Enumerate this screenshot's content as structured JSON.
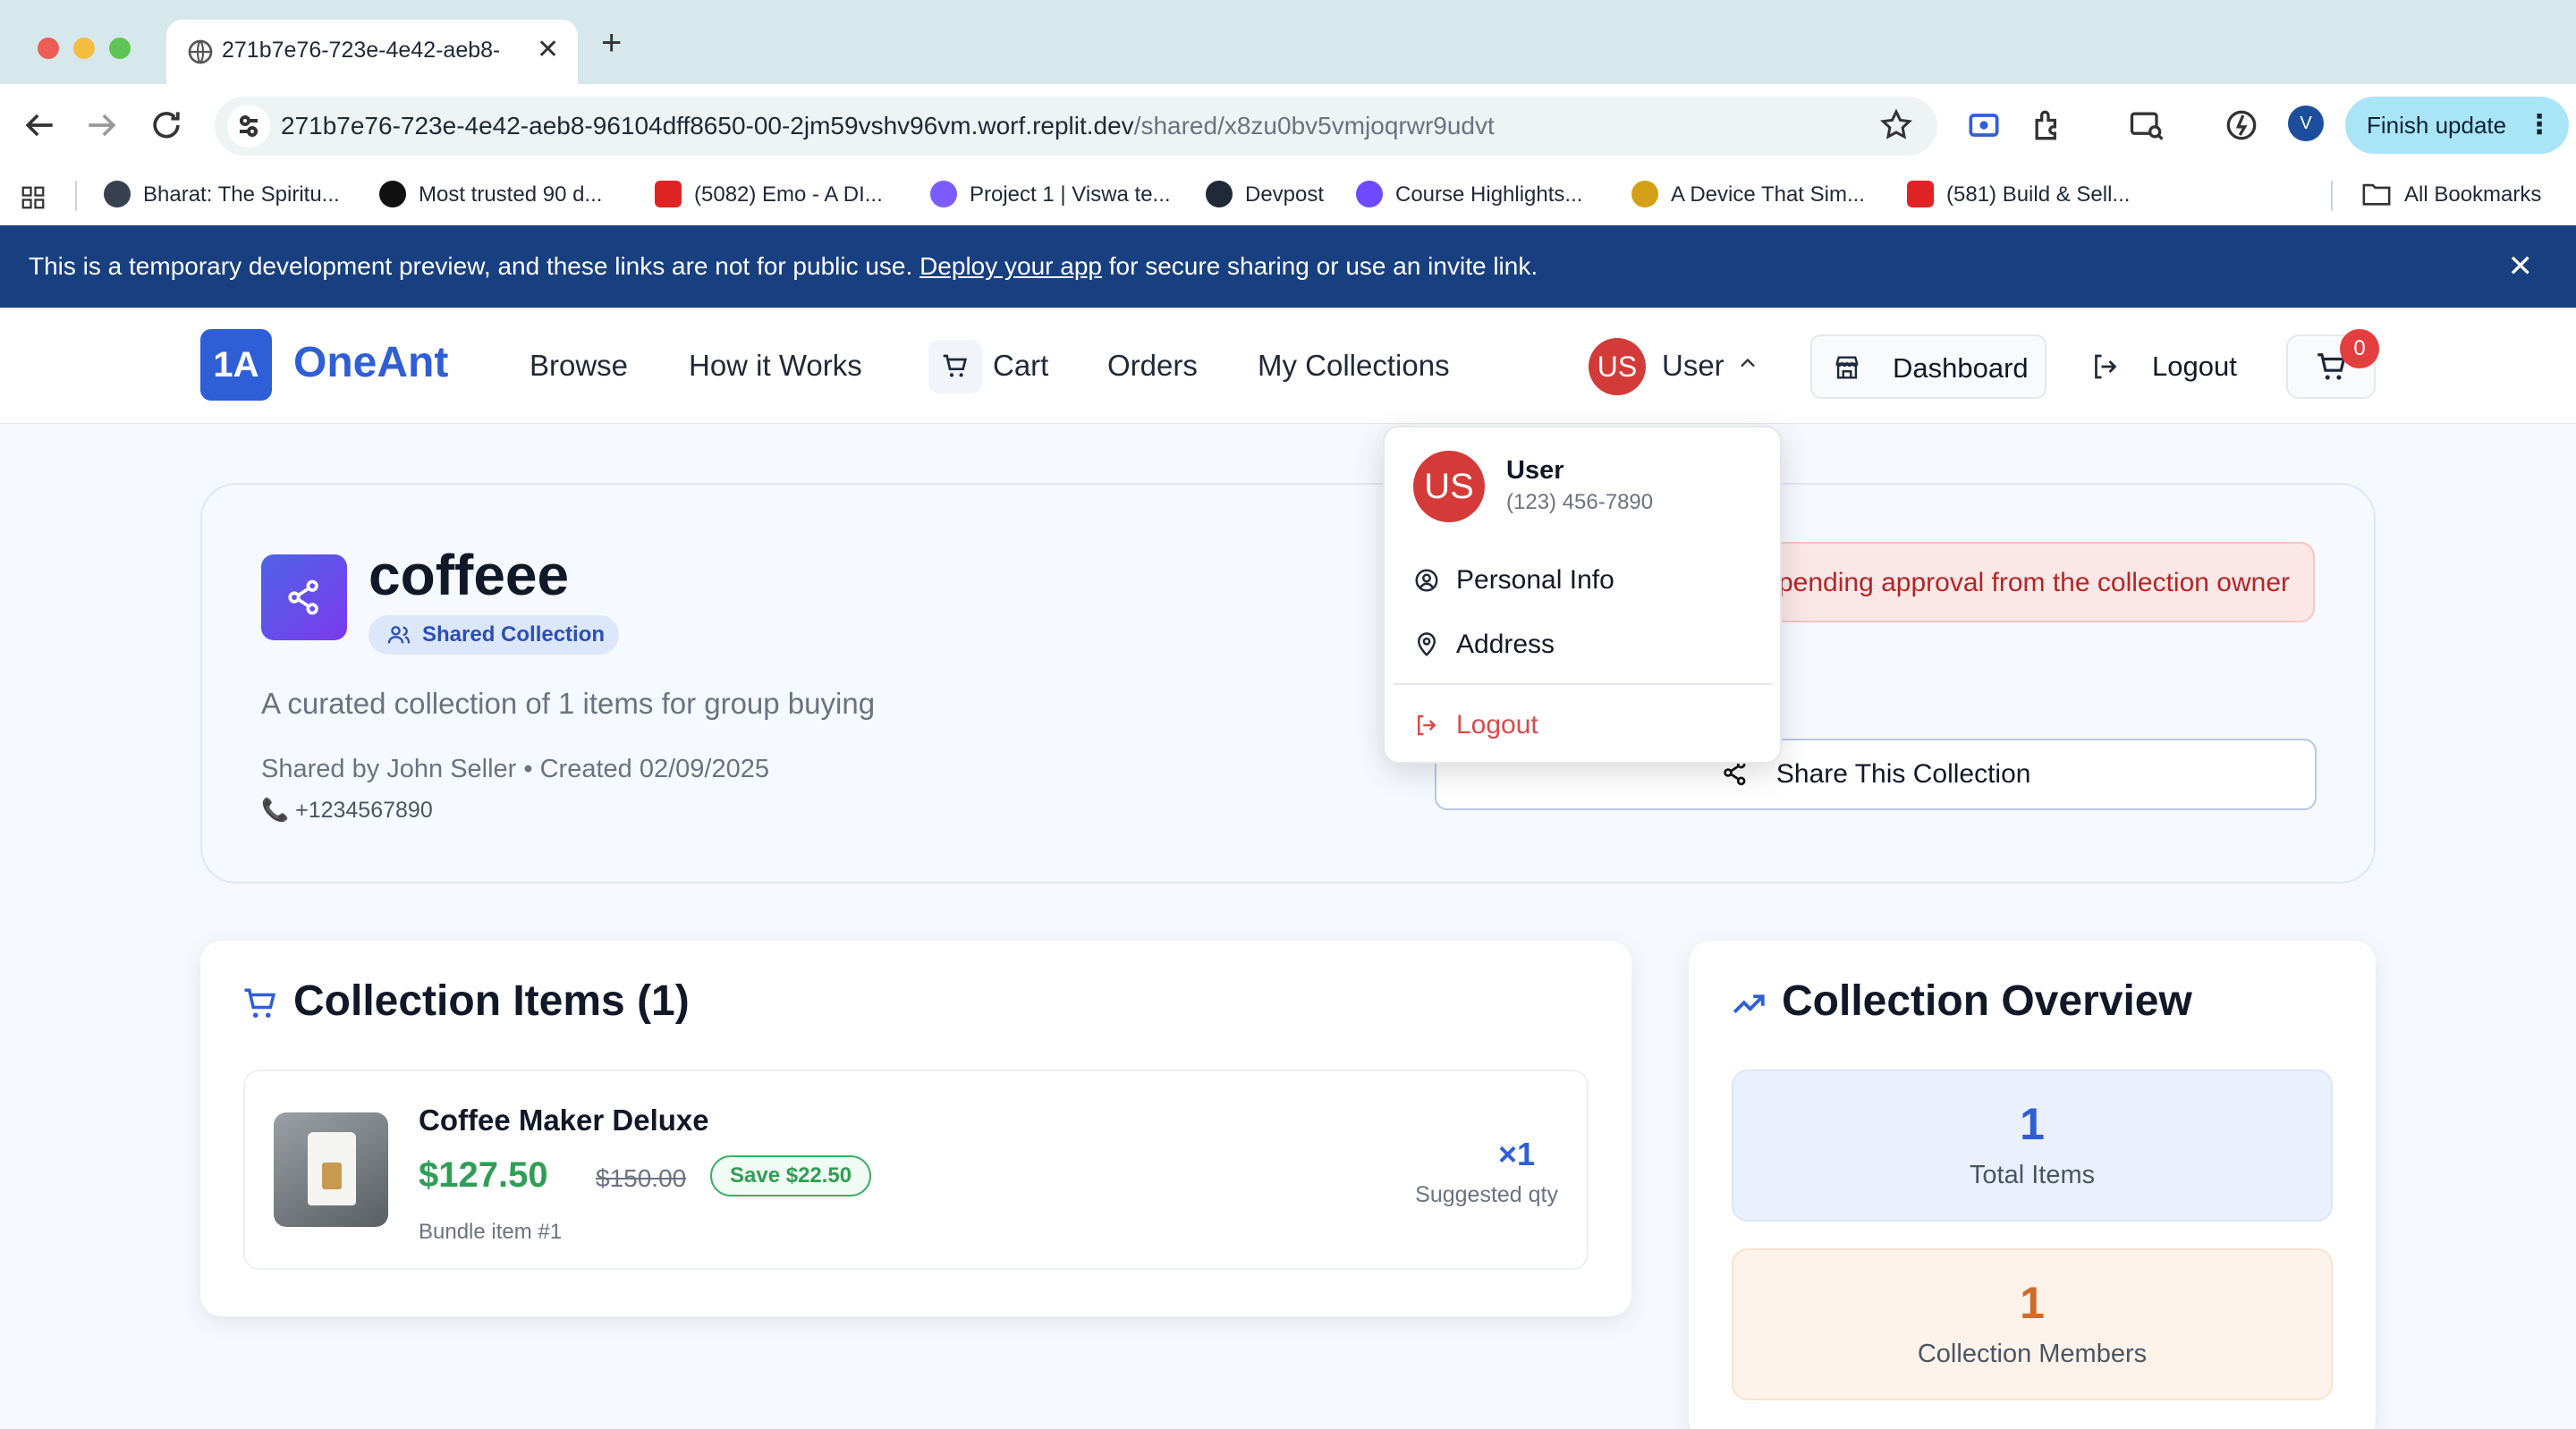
{
  "browser": {
    "tab_title": "271b7e76-723e-4e42-aeb8-96104dff8650",
    "new_tab": "+",
    "url_host": "271b7e76-723e-4e42-aeb8-96104dff8650-00-2jm59vshv96vm.worf.replit.dev",
    "url_path": "/shared/x8zu0bv5vmjoqrwr9udvt",
    "profile_initial": "V",
    "finish_update": "Finish update",
    "bookmarks": [
      {
        "label": "Bharat: The Spiritu...",
        "color": "#374151"
      },
      {
        "label": "Most trusted 90 d...",
        "color": "#111111"
      },
      {
        "label": "(5082) Emo - A DI...",
        "color": "#e02424"
      },
      {
        "label": "Project 1 | Viswa te...",
        "color": "#7c5cff"
      },
      {
        "label": "Devpost",
        "color": "#1f2937"
      },
      {
        "label": "Course Highlights...",
        "color": "#6d4aff"
      },
      {
        "label": "A Device That Sim...",
        "color": "#d4a017"
      },
      {
        "label": "(581) Build & Sell...",
        "color": "#e02424"
      }
    ],
    "all_bookmarks": "All Bookmarks"
  },
  "banner": {
    "text_before": "This is a temporary development preview, and these links are not for public use. ",
    "link": "Deploy your app",
    "text_after": " for secure sharing or use an invite link.",
    "close": "✕"
  },
  "header": {
    "logo_badge": "1A",
    "logo_text": "OneAnt",
    "nav": {
      "browse": "Browse",
      "how": "How it Works",
      "cart": "Cart",
      "orders": "Orders",
      "collections": "My Collections"
    },
    "user_initials": "US",
    "user_name": "User",
    "dashboard": "Dashboard",
    "logout": "Logout",
    "cart_count": "0"
  },
  "dropdown": {
    "initials": "US",
    "name": "User",
    "phone": "(123) 456-7890",
    "personal_info": "Personal Info",
    "address": "Address",
    "logout": "Logout"
  },
  "collection": {
    "title": "coffeee",
    "badge": "Shared Collection",
    "description": "A curated collection of 1 items for group buying",
    "meta": "Shared by John Seller • Created 02/09/2025",
    "phone": "+1234567890",
    "pending": "pending approval from the collection owner",
    "share_button": "Share This Collection"
  },
  "items_card": {
    "title": "Collection Items (1)",
    "items": [
      {
        "name": "Coffee Maker Deluxe",
        "price": "$127.50",
        "old_price": "$150.00",
        "save": "Save $22.50",
        "bundle": "Bundle item #1",
        "qty": "×1",
        "qty_label": "Suggested qty"
      }
    ]
  },
  "overview": {
    "title": "Collection Overview",
    "total_items": "1",
    "total_items_label": "Total Items",
    "members": "1",
    "members_label": "Collection Members"
  },
  "colors": {
    "brand": "#2f5fd6",
    "banner": "#183f80",
    "avatar": "#d33a38",
    "price": "#2f9e55",
    "members": "#d3692a"
  }
}
